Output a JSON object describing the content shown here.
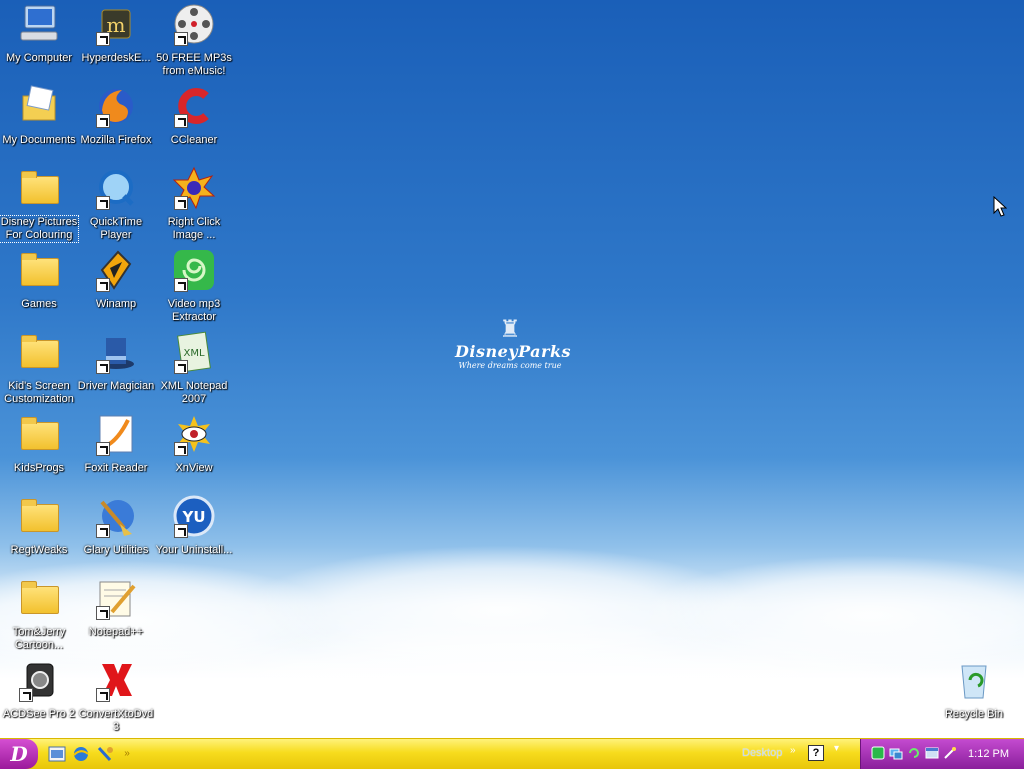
{
  "desktop": {
    "background": {
      "logo_word": "DisneyParks",
      "logo_tagline": "Where dreams come true"
    },
    "icons": {
      "my_computer": "My Computer",
      "hyperdesk": "HyperdeskE...",
      "free_mp3s": "50 FREE MP3s from eMusic!",
      "my_documents": "My Documents",
      "mozilla_firefox": "Mozilla Firefox",
      "ccleaner": "CCleaner",
      "disney_pictures": "Disney Pictures For Colouring",
      "quicktime": "QuickTime Player",
      "right_click_image": "Right Click Image ...",
      "games": "Games",
      "winamp": "Winamp",
      "video_mp3": "Video mp3 Extractor",
      "kids_screen": "Kid's Screen Customization",
      "driver_magician": "Driver Magician",
      "xml_notepad": "XML Notepad 2007",
      "kidsprogs": "KidsProgs",
      "foxit_reader": "Foxit Reader",
      "xnview": "XnView",
      "regtweaks": "RegtWeaks",
      "glary_utilities": "Glary Utilities",
      "your_uninstall": "Your Uninstall...",
      "tom_jerry": "Tom&Jerry Cartoon...",
      "notepadpp": "Notepad++",
      "acdsee": "ACDSee Pro 2",
      "convertxtodvd": "ConvertXtoDvd 3",
      "recycle_bin": "Recycle Bin"
    }
  },
  "taskbar": {
    "start_label": "D",
    "desktop_toolbar_label": "Desktop",
    "help_label": "?",
    "clock": "1:12 PM"
  },
  "colors": {
    "taskbar": "#f7dc1d",
    "start_button": "#b32bb3",
    "tray": "#a933b8",
    "sky_top": "#1a5fb8"
  }
}
